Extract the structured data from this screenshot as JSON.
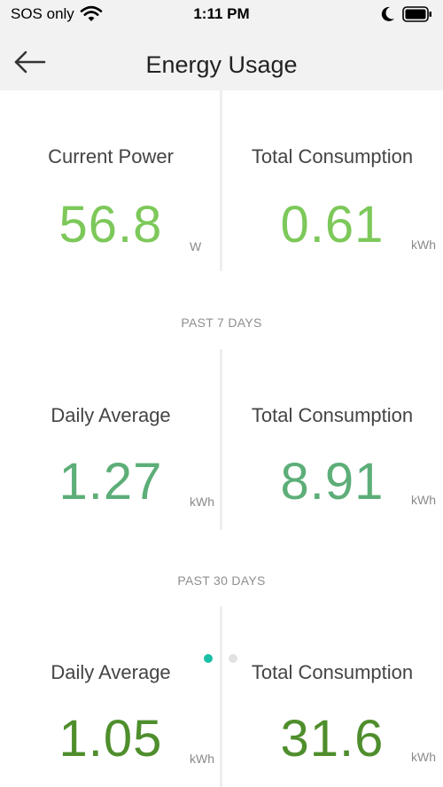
{
  "status_bar": {
    "carrier": "SOS only",
    "time": "1:11 PM"
  },
  "header": {
    "title": "Energy Usage",
    "back_icon": "arrow-left-icon"
  },
  "current": {
    "left": {
      "label": "Current Power",
      "value": "56.8",
      "unit": "W"
    },
    "right": {
      "label": "Total Consumption",
      "value": "0.61",
      "unit": "kWh"
    }
  },
  "past7": {
    "header": "PAST 7 DAYS",
    "left": {
      "label": "Daily Average",
      "value": "1.27",
      "unit": "kWh"
    },
    "right": {
      "label": "Total Consumption",
      "value": "8.91",
      "unit": "kWh"
    }
  },
  "past30": {
    "header": "PAST 30 DAYS",
    "left": {
      "label": "Daily Average",
      "value": "1.05",
      "unit": "kWh"
    },
    "right": {
      "label": "Total Consumption",
      "value": "31.6",
      "unit": "kWh"
    }
  },
  "pager": {
    "active_color": "#1bbfa8",
    "inactive_color": "#e2e2e2"
  },
  "colors": {
    "value_current": "#7dc85a",
    "value_past7": "#5dae78",
    "value_past30": "#4e8e2c"
  }
}
